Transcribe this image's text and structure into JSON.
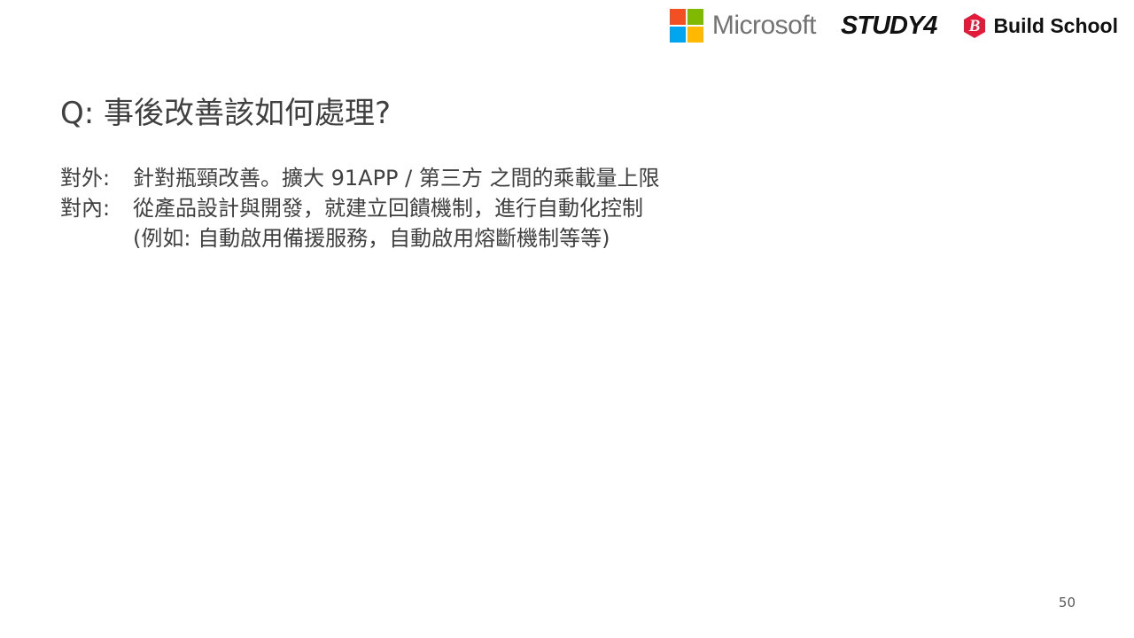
{
  "header": {
    "logos": [
      {
        "name": "Microsoft",
        "colors": [
          "#f25022",
          "#7fba00",
          "#00a4ef",
          "#ffb900"
        ]
      },
      {
        "name": "STUDY4"
      },
      {
        "name": "Build School",
        "color": "#e31b3b"
      }
    ]
  },
  "slide": {
    "title": "Q: 事後改善該如何處理?",
    "items": [
      {
        "label": "對外:",
        "lines": [
          "針對瓶頸改善。擴大 91APP / 第三方 之間的乘載量上限"
        ]
      },
      {
        "label": "對內:",
        "lines": [
          "從產品設計與開發，就建立回饋機制，進行自動化控制",
          "(例如: 自動啟用備援服務，自動啟用熔斷機制等等)"
        ]
      }
    ],
    "page_number": "50"
  }
}
